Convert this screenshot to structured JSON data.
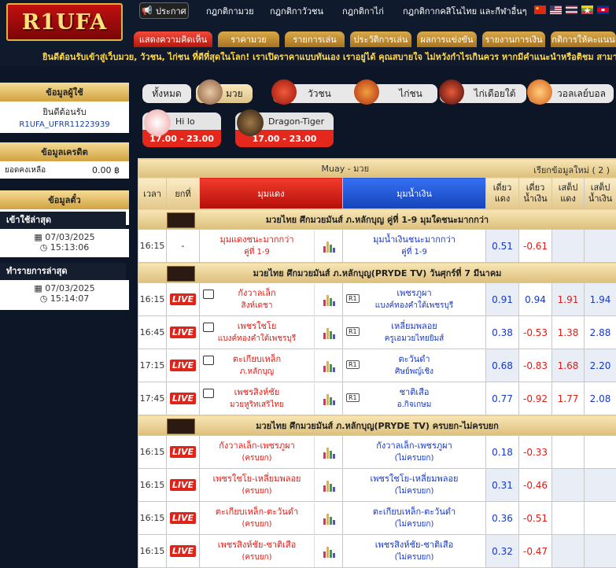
{
  "header": {
    "logo": "R1UFA",
    "announce_label": "ประกาศ",
    "top_nav": [
      "กฎกติกามวย",
      "กฎกติกาวัวชน",
      "กฎกติกาไก่",
      "กฎกติกากคสิโนไทย และกีฬาอื่นๆ"
    ],
    "flags": [
      "flag-china-icon",
      "flag-usa-icon",
      "flag-thailand-icon",
      "flag-myanmar-icon",
      "flag-cambodia-icon"
    ],
    "main_nav": [
      "แสดงความคิดเห็น",
      "ราคามวย",
      "รายการเล่น",
      "ประวัติการเล่น",
      "ผลการแข่งขัน",
      "รายงานการเงิน",
      "กติการให้คะแนน"
    ]
  },
  "marquee": "ยินดีต้อนรับเข้าสู่เว็บมวย, วัวชน, ไก่ชน ที่ดีที่สุดในโลก! เราเปิดราคาแบบทันเอง เราอยู่ได้ คุณสบายใจ ไม่หวังกำไรเกินควร หากมีคำแนะนำหรือติชม สามารถแจ้งได้ที่ปุ่ม \"แ",
  "sidebar": {
    "user_title": "ข้อมูลผู้ใช้",
    "welcome": "ยินดีต้อนรับ",
    "username": "R1UFA_UFRR11223939",
    "credit_title": "ข้อมูลเครดิต",
    "balance_label": "ยอดคงเหลือ",
    "balance_value": "0.00 ฿",
    "ticket_title": "ข้อมูลตั๋ว",
    "last_login_label": "เข้าใช้ล่าสุด",
    "last_login_date": "07/03/2025",
    "last_login_time": "15:13:06",
    "last_tx_label": "ทำรายการล่าสุด",
    "last_tx_date": "07/03/2025",
    "last_tx_time": "15:14:07"
  },
  "tabs": [
    "ทั้งหมด",
    "มวย",
    "วัวชน",
    "ไก่ชน",
    "ไก่เดือยใต้",
    "วอลเลย์บอล"
  ],
  "games": [
    {
      "name": "Hi lo",
      "hours": "17.00 - 23.00"
    },
    {
      "name": "Dragon-Tiger",
      "hours": "17.00 - 23.00"
    }
  ],
  "table": {
    "title": "Muay - มวย",
    "refresh": "เรียกข้อมูลใหม่ ( 2 )",
    "headers": {
      "time": "เวลา",
      "cancel": "ยกที่",
      "red": "มุมแดง",
      "blue": "มุมน้ำเงิน",
      "odd_red": "เดี่ยว\nแดง",
      "odd_blue": "เดี่ยว\nน้ำเงิน",
      "set_red": "เสต็ป\nแดง",
      "set_blue": "เสต็ป\nน้ำเงิน"
    },
    "live_label": "LIVE",
    "round_label": "R1",
    "leagues": [
      {
        "name": "มวยไทย ศึกมวยมันส์ ภ.หลักบุญ คู่ที่ 1-9 มุมใดชนะมากกว่า",
        "matches": [
          {
            "time": "16:15",
            "cancel": "-",
            "live": false,
            "red": "มุมแดงชนะมากกว่า",
            "red_sub": "คู่ที่ 1-9",
            "blue": "มุมน้ำเงินชนะมากกว่า",
            "blue_sub": "คู่ที่ 1-9",
            "o1": "0.51",
            "o2": "-0.61",
            "s1": "",
            "s2": ""
          }
        ]
      },
      {
        "name": "มวยไทย ศึกมวยมันส์ ภ.หลักบุญ(PRYDE TV) วันศุกร์ที่ 7 มีนาคม",
        "matches": [
          {
            "time": "16:15",
            "live": true,
            "red": "กังวาลเล็ก",
            "red_sub": "สิงห์เดชา",
            "blue": "เพชรภูผา",
            "blue_sub": "แบงค์ทองคำใต้เพชรบุรี",
            "o1": "0.91",
            "o2": "0.94",
            "s1": "1.91",
            "s2": "1.94"
          },
          {
            "time": "16:45",
            "live": true,
            "red": "เพชรใชโย",
            "red_sub": "แบงค์ทองคำใต้เพชรบุรี",
            "blue": "เหลี่ยมพลอย",
            "blue_sub": "ครูเอมวยไทยยิมส์",
            "o1": "0.38",
            "o2": "-0.53",
            "s1": "1.38",
            "s2": "2.88"
          },
          {
            "time": "17:15",
            "live": true,
            "red": "ตะเกียบเหล็ก",
            "red_sub": "ภ.หลักบุญ",
            "blue": "ตะวันดำ",
            "blue_sub": "ศิษย์พญ์เชิง",
            "o1": "0.68",
            "o2": "-0.83",
            "s1": "1.68",
            "s2": "2.20"
          },
          {
            "time": "17:45",
            "live": true,
            "red": "เพชรสิงห์ชัย",
            "red_sub": "มวยหูริทเสริไทย",
            "blue": "ชาติเสือ",
            "blue_sub": "อ.กิจเกษม",
            "o1": "0.77",
            "o2": "-0.92",
            "s1": "1.77",
            "s2": "2.08"
          }
        ]
      },
      {
        "name": "มวยไทย ศึกมวยมันส์ ภ.หลักบุญ(PRYDE TV) ครบยก-ไม่ครบยก",
        "matches": [
          {
            "time": "16:15",
            "live": true,
            "red": "กังวาลเล็ก-เพชรภูผา",
            "red_sub": "(ครบยก)",
            "blue": "กังวาลเล็ก-เพชรภูผา",
            "blue_sub": "(ไม่ครบยก)",
            "o1": "0.18",
            "o2": "-0.33",
            "s1": "",
            "s2": ""
          },
          {
            "time": "16:15",
            "live": true,
            "red": "เพชรใชโย-เหลี่ยมพลอย",
            "red_sub": "(ครบยก)",
            "blue": "เพชรใชโย-เหลี่ยมพลอย",
            "blue_sub": "(ไม่ครบยก)",
            "o1": "0.31",
            "o2": "-0.46",
            "s1": "",
            "s2": ""
          },
          {
            "time": "16:15",
            "live": true,
            "red": "ตะเกียบเหล็ก-ตะวันดำ",
            "red_sub": "(ครบยก)",
            "blue": "ตะเกียบเหล็ก-ตะวันดำ",
            "blue_sub": "(ไม่ครบยก)",
            "o1": "0.36",
            "o2": "-0.51",
            "s1": "",
            "s2": ""
          },
          {
            "time": "16:15",
            "live": true,
            "red": "เพชรสิงห์ชัย-ชาติเสือ",
            "red_sub": "(ครบยก)",
            "blue": "เพชรสิงห์ชัย-ชาติเสือ",
            "blue_sub": "(ไม่ครบยก)",
            "o1": "0.32",
            "o2": "-0.47",
            "s1": "",
            "s2": ""
          }
        ]
      }
    ]
  }
}
